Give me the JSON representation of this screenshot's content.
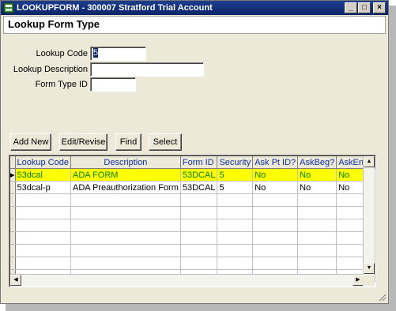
{
  "window": {
    "title": "LOOKUPFORM - 300007 Stratford Trial Account",
    "minimize_symbol": "_",
    "maximize_symbol": "□",
    "close_symbol": "×"
  },
  "header": {
    "title": "Lookup Form Type"
  },
  "form": {
    "lookup_code_label": "Lookup Code",
    "lookup_code_value": "5",
    "lookup_description_label": "Lookup Description",
    "lookup_description_value": "",
    "form_type_id_label": "Form Type ID",
    "form_type_id_value": ""
  },
  "buttons": {
    "add_new": "Add New",
    "edit_revise": "Edit/Revise",
    "find": "Find",
    "select": "Select"
  },
  "grid": {
    "columns": [
      "Lookup Code",
      "Description",
      "Form ID",
      "Security",
      "Ask Pt ID?",
      "AskBeg?",
      "AskEnd?"
    ],
    "rows": [
      {
        "indicator": "▸",
        "cells": [
          "53dcal",
          "ADA FORM",
          "53DCAL",
          "5",
          "No",
          "No",
          "No"
        ]
      },
      {
        "indicator": "",
        "cells": [
          "53dcal-p",
          "ADA Preauthorization Form",
          "53DCAL",
          "5",
          "No",
          "No",
          "No"
        ]
      }
    ]
  },
  "colors": {
    "title_bar": "#0a246a",
    "highlight_row": "#ffff00",
    "highlight_text": "#008000",
    "header_text": "#1030a0"
  }
}
